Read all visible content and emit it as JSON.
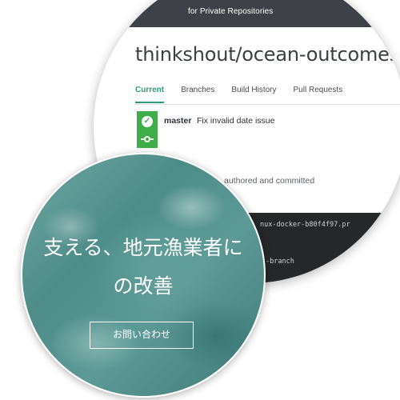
{
  "ci": {
    "topbar_text": "for Private Repositories",
    "repo_title": "thinkshout/ocean-outcomes",
    "tabs": [
      {
        "label": "Current",
        "active": true
      },
      {
        "label": "Branches"
      },
      {
        "label": "Build History"
      },
      {
        "label": "Pull Requests"
      }
    ],
    "build": {
      "status": "passed",
      "status_color": "#3fae49",
      "branch": "master",
      "message": "Fix invalid date issue",
      "meta": "authored and committed"
    },
    "log": {
      "line1": "nux-docker-b80f4f97.pr",
      "line2": "-branch"
    }
  },
  "hero": {
    "line1": "支える、地元漁業者に",
    "line2": "の改善",
    "button_label": "お問い合わせ"
  },
  "colors": {
    "accent": "#2f9c7d",
    "topbar": "#3e4147",
    "teal": "#5d9a95"
  }
}
